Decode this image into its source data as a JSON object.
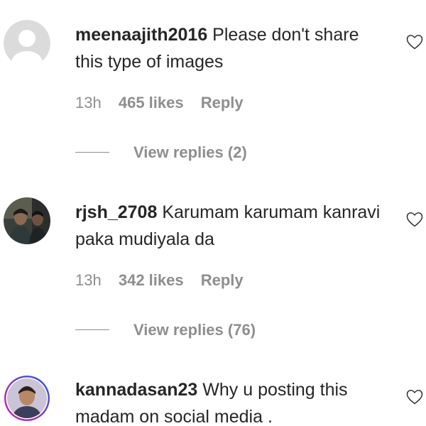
{
  "comments": [
    {
      "username": "meenaajith2016",
      "text": "Please don't share this type of images",
      "time": "13h",
      "likes": "465 likes",
      "reply_label": "Reply",
      "view_replies": "View replies (2)",
      "avatar": "default-avatar",
      "like_icon": "heart-outline-icon"
    },
    {
      "username": "rjsh_2708",
      "text": "Karumam karumam kanravi paka mudiyala da",
      "time": "13h",
      "likes": "342 likes",
      "reply_label": "Reply",
      "view_replies": "View replies (76)",
      "avatar": "photo-avatar",
      "like_icon": "heart-outline-icon"
    },
    {
      "username": "kannadasan23",
      "text": "Why u posting this madam on social media .",
      "avatar": "story-ring-avatar",
      "like_icon": "heart-outline-icon"
    }
  ],
  "colors": {
    "text": "#262626",
    "secondary": "#8e8e8e",
    "story_ring_start": "#d6249f",
    "story_ring_end": "#285AEB"
  }
}
